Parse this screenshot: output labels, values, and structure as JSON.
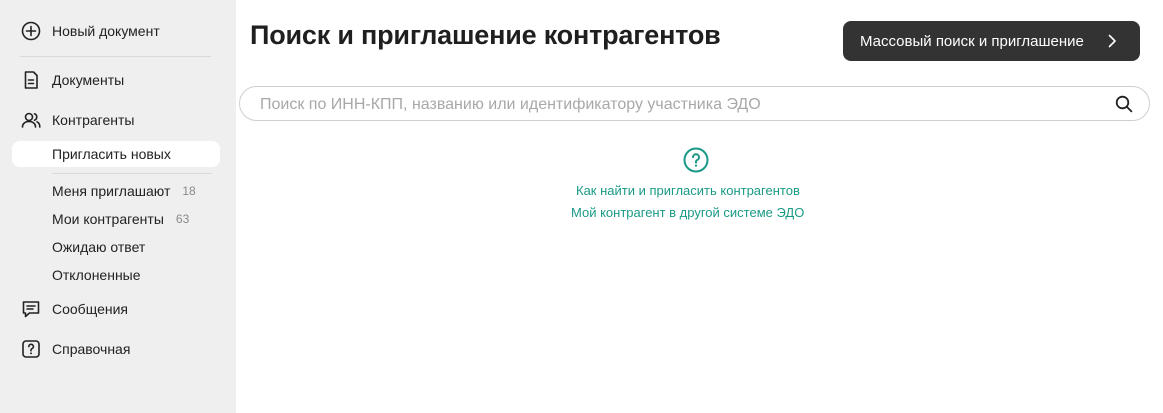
{
  "sidebar": {
    "new_document": "Новый документ",
    "documents": "Документы",
    "counterparties": "Контрагенты",
    "sub_items": [
      {
        "label": "Пригласить новых",
        "count": ""
      },
      {
        "label": "Меня приглашают",
        "count": "18"
      },
      {
        "label": "Мои контрагенты",
        "count": "63"
      },
      {
        "label": "Ожидаю ответ",
        "count": ""
      },
      {
        "label": "Отклоненные",
        "count": ""
      }
    ],
    "messages": "Сообщения",
    "help": "Справочная"
  },
  "main": {
    "title": "Поиск и приглашение контрагентов",
    "mass_button": "Массовый поиск и приглашение",
    "search_placeholder": "Поиск по ИНН-КПП, названию или идентификатору участника ЭДО",
    "search_value": "",
    "links": [
      "Как найти и пригласить контрагентов",
      "Мой контрагент в другой системе ЭДО"
    ]
  },
  "colors": {
    "sidebar_bg": "#efefef",
    "accent": "#1a9a86",
    "button_bg": "#333333"
  }
}
